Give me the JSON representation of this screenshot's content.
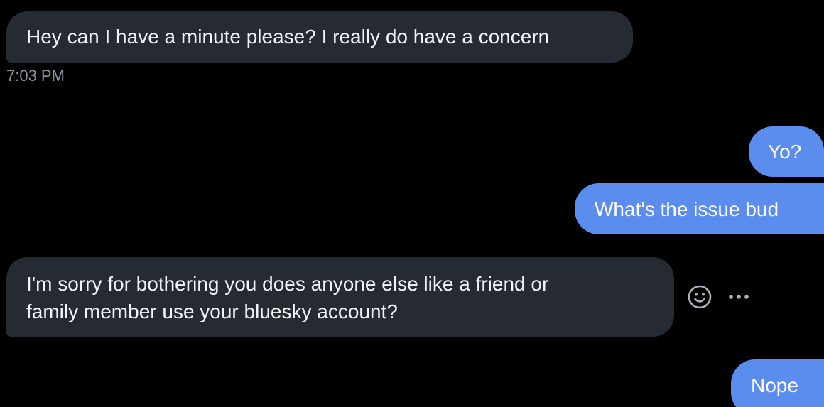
{
  "messages": [
    {
      "id": "msg1",
      "direction": "incoming",
      "text": "Hey can I have a minute please? I really do have a concern"
    },
    {
      "id": "msg2",
      "direction": "outgoing",
      "text": "Yo?"
    },
    {
      "id": "msg3",
      "direction": "outgoing",
      "text": "What's the issue bud"
    },
    {
      "id": "msg4",
      "direction": "incoming",
      "lines": [
        "I'm sorry for bothering you does anyone else like a friend or",
        "family member use your bluesky account?"
      ]
    },
    {
      "id": "msg5",
      "direction": "outgoing",
      "text": "Nope"
    }
  ],
  "timestamps": {
    "first": "7:03 PM"
  },
  "message_actions": {
    "react_icon": "smiley-face-icon",
    "more_icon": "ellipsis-icon"
  },
  "colors": {
    "background": "#000000",
    "incoming_bubble": "#262b33",
    "outgoing_bubble": "#5b8def",
    "timestamp_text": "#8b95a3"
  }
}
